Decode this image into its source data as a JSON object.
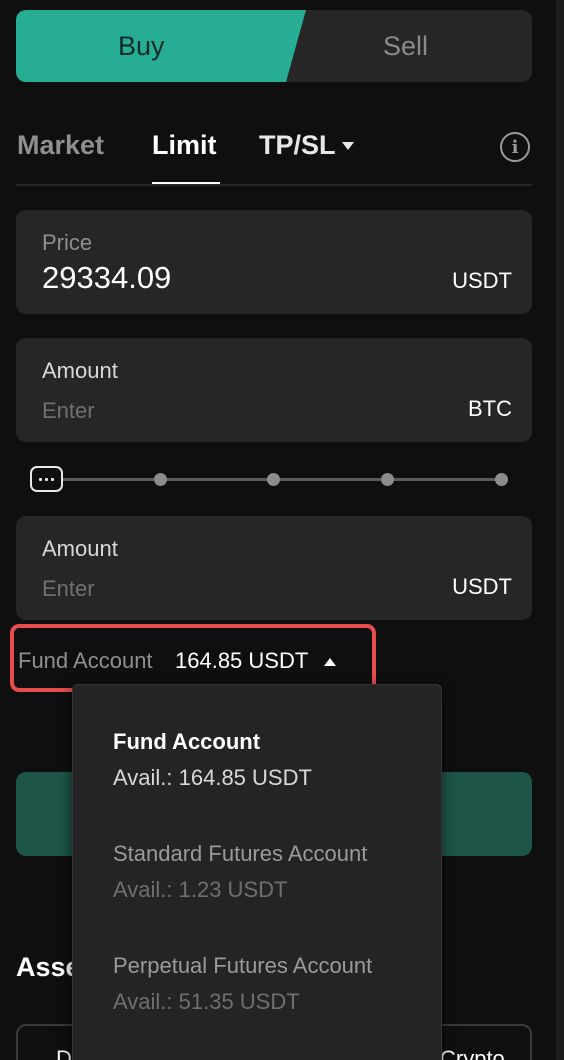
{
  "side_toggle": {
    "buy_label": "Buy",
    "sell_label": "Sell"
  },
  "order_tabs": {
    "market": "Market",
    "limit": "Limit",
    "tpsl": "TP/SL"
  },
  "price": {
    "label": "Price",
    "value": "29334.09",
    "unit": "USDT"
  },
  "amount_btc": {
    "label": "Amount",
    "placeholder": "Enter",
    "unit": "BTC"
  },
  "amount_usdt": {
    "label": "Amount",
    "placeholder": "Enter",
    "unit": "USDT"
  },
  "fund_selector": {
    "label": "Fund Account",
    "amount": "164.85 USDT"
  },
  "assets": {
    "title_partial": "Asse",
    "left_partial": "D",
    "right_partial": "Crypto"
  },
  "dropdown": {
    "items": [
      {
        "name": "Fund Account",
        "avail": "Avail.: 164.85 USDT"
      },
      {
        "name": "Standard Futures Account",
        "avail": "Avail.: 1.23 USDT"
      },
      {
        "name": "Perpetual Futures Account",
        "avail": "Avail.: 51.35 USDT"
      }
    ]
  },
  "colors": {
    "buy": "#27ad94",
    "highlight_border": "#e84c4c",
    "background": "#0f0f0f",
    "panel": "#262626"
  },
  "icons": {
    "info": "info-icon",
    "tpsl_caret": "chevron-down-icon",
    "fund_caret": "chevron-up-icon",
    "slider_handle": "slider-handle-icon"
  }
}
